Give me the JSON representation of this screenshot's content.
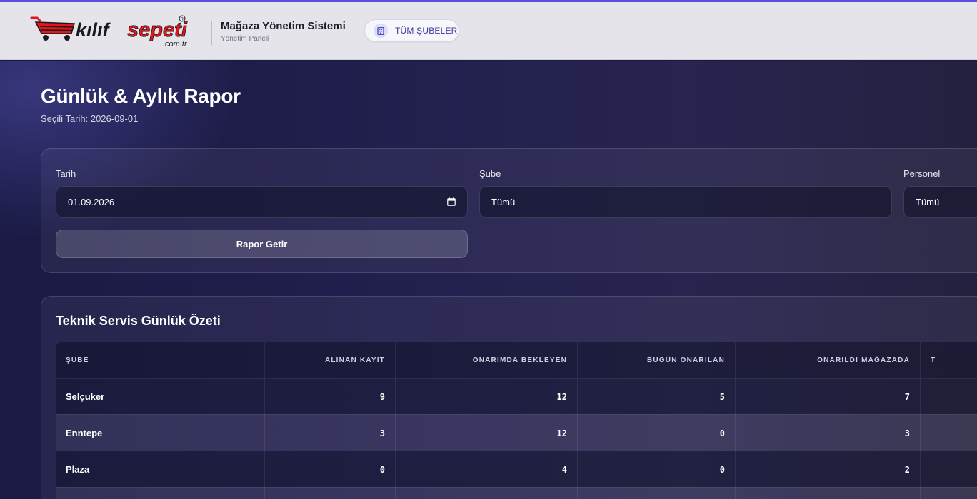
{
  "header": {
    "logo_text": "kılıf sepeti .com.tr",
    "title": "Mağaza Yönetim Sistemi",
    "subtitle": "Yönetim Paneli",
    "branch_button": "TÜM ŞUBELER",
    "branch_icon": "building-icon"
  },
  "page": {
    "title": "Günlük & Aylık Rapor",
    "selected_date": "Seçili Tarih: 2026-09-01"
  },
  "filters": {
    "date_label": "Tarih",
    "date_value": "01.09.2026",
    "branch_label": "Şube",
    "branch_value": "Tümü",
    "staff_label": "Personel",
    "staff_value": "Tümü",
    "submit_label": "Rapor Getir"
  },
  "summary": {
    "title": "Teknik Servis Günlük Özeti",
    "columns": [
      "ŞUBE",
      "ALINAN KAYIT",
      "ONARIMDA BEKLEYEN",
      "BUGÜN ONARILAN",
      "ONARILDI MAĞAZADA",
      "T"
    ],
    "rows": [
      {
        "branch": "Selçuker",
        "received": "9",
        "waiting": "12",
        "repaired_today": "5",
        "in_store": "7"
      },
      {
        "branch": "Enntepe",
        "received": "3",
        "waiting": "12",
        "repaired_today": "0",
        "in_store": "3"
      },
      {
        "branch": "Plaza",
        "received": "0",
        "waiting": "4",
        "repaired_today": "0",
        "in_store": "2"
      }
    ]
  },
  "colors": {
    "accent": "#5b4fe0",
    "header_bg": "#e4e4ea",
    "background": "#1c1a45",
    "logo_red": "#e3161f"
  }
}
